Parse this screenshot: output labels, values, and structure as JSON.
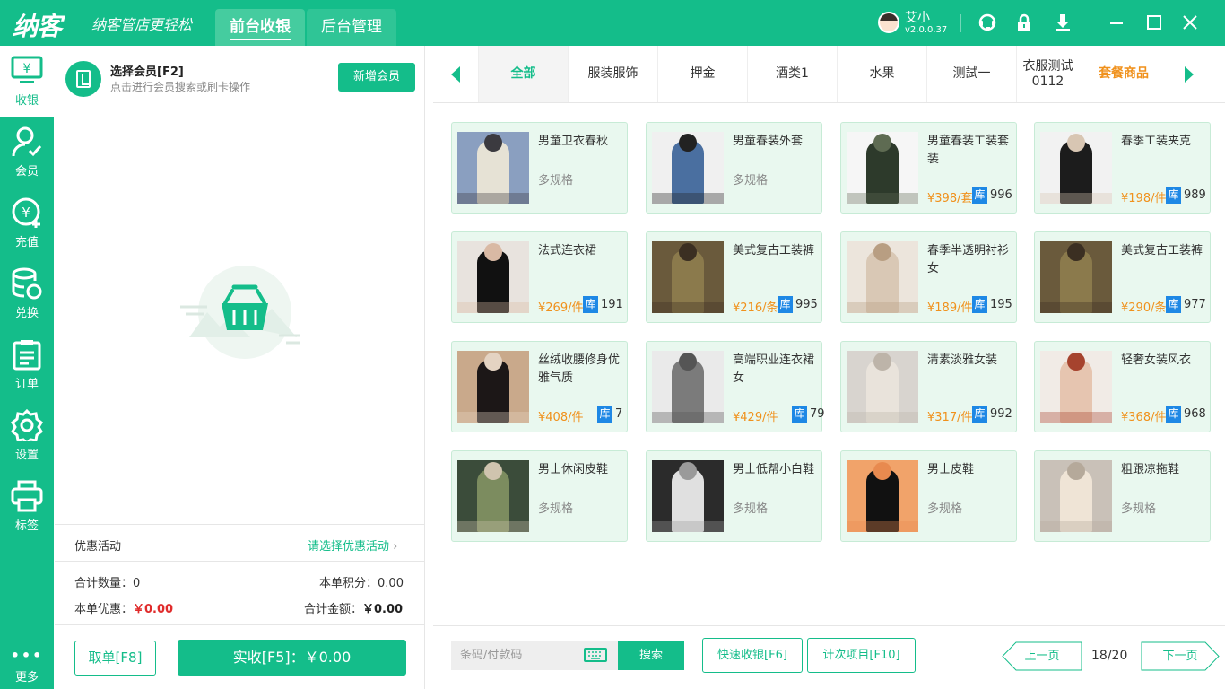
{
  "app": {
    "logo": "纳客",
    "slogan": "纳客管店更轻松",
    "nav_front": "前台收银",
    "nav_back": "后台管理",
    "user_name": "艾小",
    "version": "v2.0.0.37"
  },
  "sidebar": {
    "items": [
      {
        "label": "收银",
        "icon": "cashier-icon"
      },
      {
        "label": "会员",
        "icon": "member-icon"
      },
      {
        "label": "充值",
        "icon": "recharge-icon"
      },
      {
        "label": "兑换",
        "icon": "exchange-icon"
      },
      {
        "label": "订单",
        "icon": "order-icon"
      },
      {
        "label": "设置",
        "icon": "settings-icon"
      },
      {
        "label": "标签",
        "icon": "print-icon"
      }
    ],
    "more": "更多"
  },
  "member": {
    "title": "选择会员[F2]",
    "subtitle": "点击进行会员搜索或刷卡操作",
    "new_button": "新增会员"
  },
  "promo": {
    "label": "优惠活动",
    "select": "请选择优惠活动"
  },
  "summary": {
    "qty_label": "合计数量：",
    "qty": "0",
    "points_label": "本单积分：",
    "points": "0.00",
    "discount_label": "本单优惠：",
    "discount": "￥0.00",
    "total_label": "合计金额：",
    "total": "￥0.00"
  },
  "actions": {
    "cancel": "取单[F8]",
    "pay": "实收[F5]：￥0.00"
  },
  "categories": [
    {
      "label": "全部"
    },
    {
      "label": "服装服饰"
    },
    {
      "label": "押金"
    },
    {
      "label": "酒类1"
    },
    {
      "label": "水果"
    },
    {
      "label": "测試一"
    },
    {
      "label": "衣服测试\n0112"
    },
    {
      "label": "套餐商品"
    }
  ],
  "products": [
    {
      "name": "男童卫衣春秋",
      "spec": "多规格",
      "price": "",
      "stock": "",
      "colors": [
        "#8a9fc0",
        "#e6e2d5",
        "#3b3a3f"
      ]
    },
    {
      "name": "男童春装外套",
      "spec": "多规格",
      "price": "",
      "stock": "",
      "colors": [
        "#f0f0f0",
        "#4a6fa0",
        "#222"
      ]
    },
    {
      "name": "男童春装工装套装",
      "spec": "",
      "price": "¥398/套",
      "stock": "996",
      "colors": [
        "#f6f6f6",
        "#2d3a2b",
        "#5e6b52"
      ]
    },
    {
      "name": "春季工装夹克",
      "spec": "",
      "price": "¥198/件",
      "stock": "989",
      "colors": [
        "#f2f2f2",
        "#1c1c1c",
        "#d8c6b3"
      ]
    },
    {
      "name": "法式连衣裙",
      "spec": "",
      "price": "¥269/件",
      "stock": "191",
      "colors": [
        "#e8e3de",
        "#111",
        "#d9b9a4"
      ]
    },
    {
      "name": "美式复古工装裤",
      "spec": "",
      "price": "¥216/条",
      "stock": "995",
      "colors": [
        "#6a5a3c",
        "#8b7a4c",
        "#3b2f22"
      ]
    },
    {
      "name": "春季半透明衬衫女",
      "spec": "",
      "price": "¥189/件",
      "stock": "195",
      "colors": [
        "#ece5dc",
        "#d9c8b5",
        "#b89e82"
      ]
    },
    {
      "name": "美式复古工装裤",
      "spec": "",
      "price": "¥290/条",
      "stock": "977",
      "colors": [
        "#6a5a3c",
        "#8b7a4c",
        "#3b2f22"
      ]
    },
    {
      "name": "丝绒收腰修身优雅气质",
      "spec": "",
      "price": "¥408/件",
      "stock": "7",
      "colors": [
        "#c9a98b",
        "#1c1717",
        "#e4d3c2"
      ]
    },
    {
      "name": "高端职业连衣裙女",
      "spec": "",
      "price": "¥429/件",
      "stock": "79",
      "colors": [
        "#eaeaea",
        "#7b7b7b",
        "#555"
      ]
    },
    {
      "name": "清素淡雅女装",
      "spec": "",
      "price": "¥317/件",
      "stock": "992",
      "colors": [
        "#d8d4cf",
        "#e9e3db",
        "#bdb4a9"
      ]
    },
    {
      "name": "轻奢女装风衣",
      "spec": "",
      "price": "¥368/件",
      "stock": "968",
      "colors": [
        "#f1ebe6",
        "#e6c5b0",
        "#a6432e"
      ]
    },
    {
      "name": "男士休闲皮鞋",
      "spec": "多规格",
      "price": "",
      "stock": "",
      "colors": [
        "#3b4c3a",
        "#7c8c5f",
        "#cfc4ae"
      ]
    },
    {
      "name": "男士低帮小白鞋",
      "spec": "多规格",
      "price": "",
      "stock": "",
      "colors": [
        "#2b2b2b",
        "#e0e0e0",
        "#9a9a9a"
      ]
    },
    {
      "name": "男士皮鞋",
      "spec": "多规格",
      "price": "",
      "stock": "",
      "colors": [
        "#f1a36a",
        "#111",
        "#e88a4f"
      ]
    },
    {
      "name": "粗跟凉拖鞋",
      "spec": "多规格",
      "price": "",
      "stock": "",
      "colors": [
        "#c9c1b8",
        "#efe4d6",
        "#b5a99a"
      ]
    }
  ],
  "bottom": {
    "scan_placeholder": "条码/付款码",
    "search": "搜索",
    "quick": "快速收银[F6]",
    "count_item": "计次项目[F10]",
    "prev": "上一页",
    "page": "18/20",
    "next": "下一页"
  },
  "colors": {
    "accent": "#14bd8a",
    "price": "#f0911c",
    "stock_tag": "#1e88e5",
    "danger": "#e02c2c"
  }
}
